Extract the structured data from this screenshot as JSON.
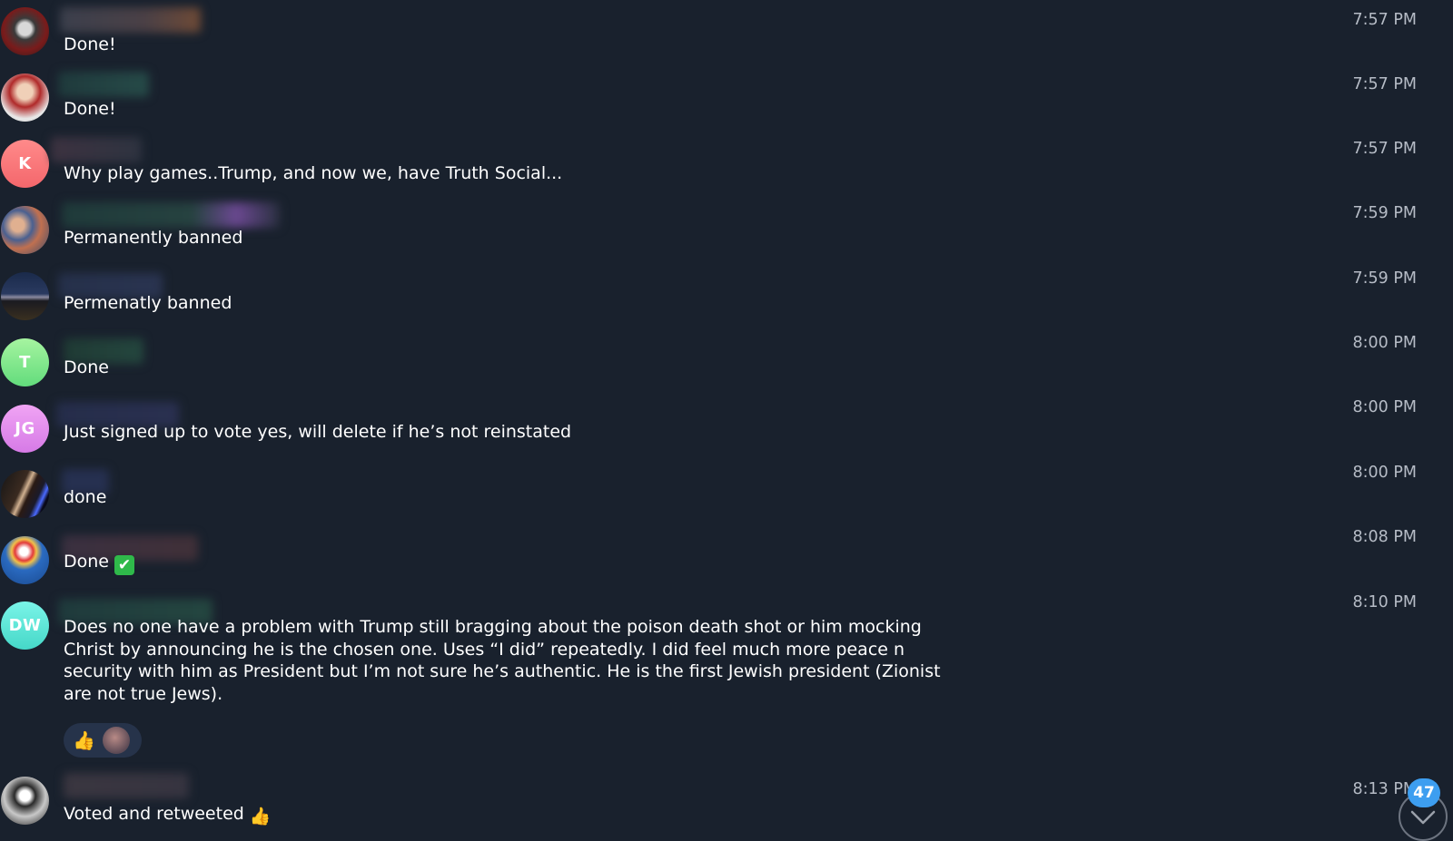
{
  "messages": [
    {
      "text": "Done!",
      "time": "7:57 PM"
    },
    {
      "text": "Done!",
      "time": "7:57 PM"
    },
    {
      "initials": "K",
      "text": "Why play games..Trump, and now we, have Truth Social...",
      "time": "7:57 PM"
    },
    {
      "text": "Permanently banned",
      "time": "7:59 PM"
    },
    {
      "text": "Permenatly banned",
      "time": "7:59 PM"
    },
    {
      "initials": "T",
      "text": "Done",
      "time": "8:00 PM"
    },
    {
      "initials": "JG",
      "text": "Just signed up to vote yes, will delete if he’s not reinstated",
      "time": "8:00 PM"
    },
    {
      "text": "done",
      "time": "8:00 PM"
    },
    {
      "text": "Done",
      "emoji": "✔",
      "time": "8:08 PM"
    },
    {
      "initials": "DW",
      "text": "Does no one have a problem with Trump still bragging about the poison death shot or him mocking Christ by announcing he is the chosen one. Uses “I did” repeatedly. I did feel much more peace n security with him as President but I’m not sure he’s authentic. He is the first Jewish president (Zionist are not true Jews).",
      "reaction": "👍",
      "time": "8:10 PM"
    },
    {
      "text": "Voted and retweeted",
      "emoji": "👍",
      "time": "8:13 PM"
    }
  ],
  "unread_count": "47",
  "icons": [
    "thumbs-up-icon",
    "check-mark-icon",
    "chevron-down-icon"
  ],
  "colors": {
    "background": "#19212d",
    "badge": "#3d9ef0",
    "timestamp": "#b6bcc6"
  }
}
